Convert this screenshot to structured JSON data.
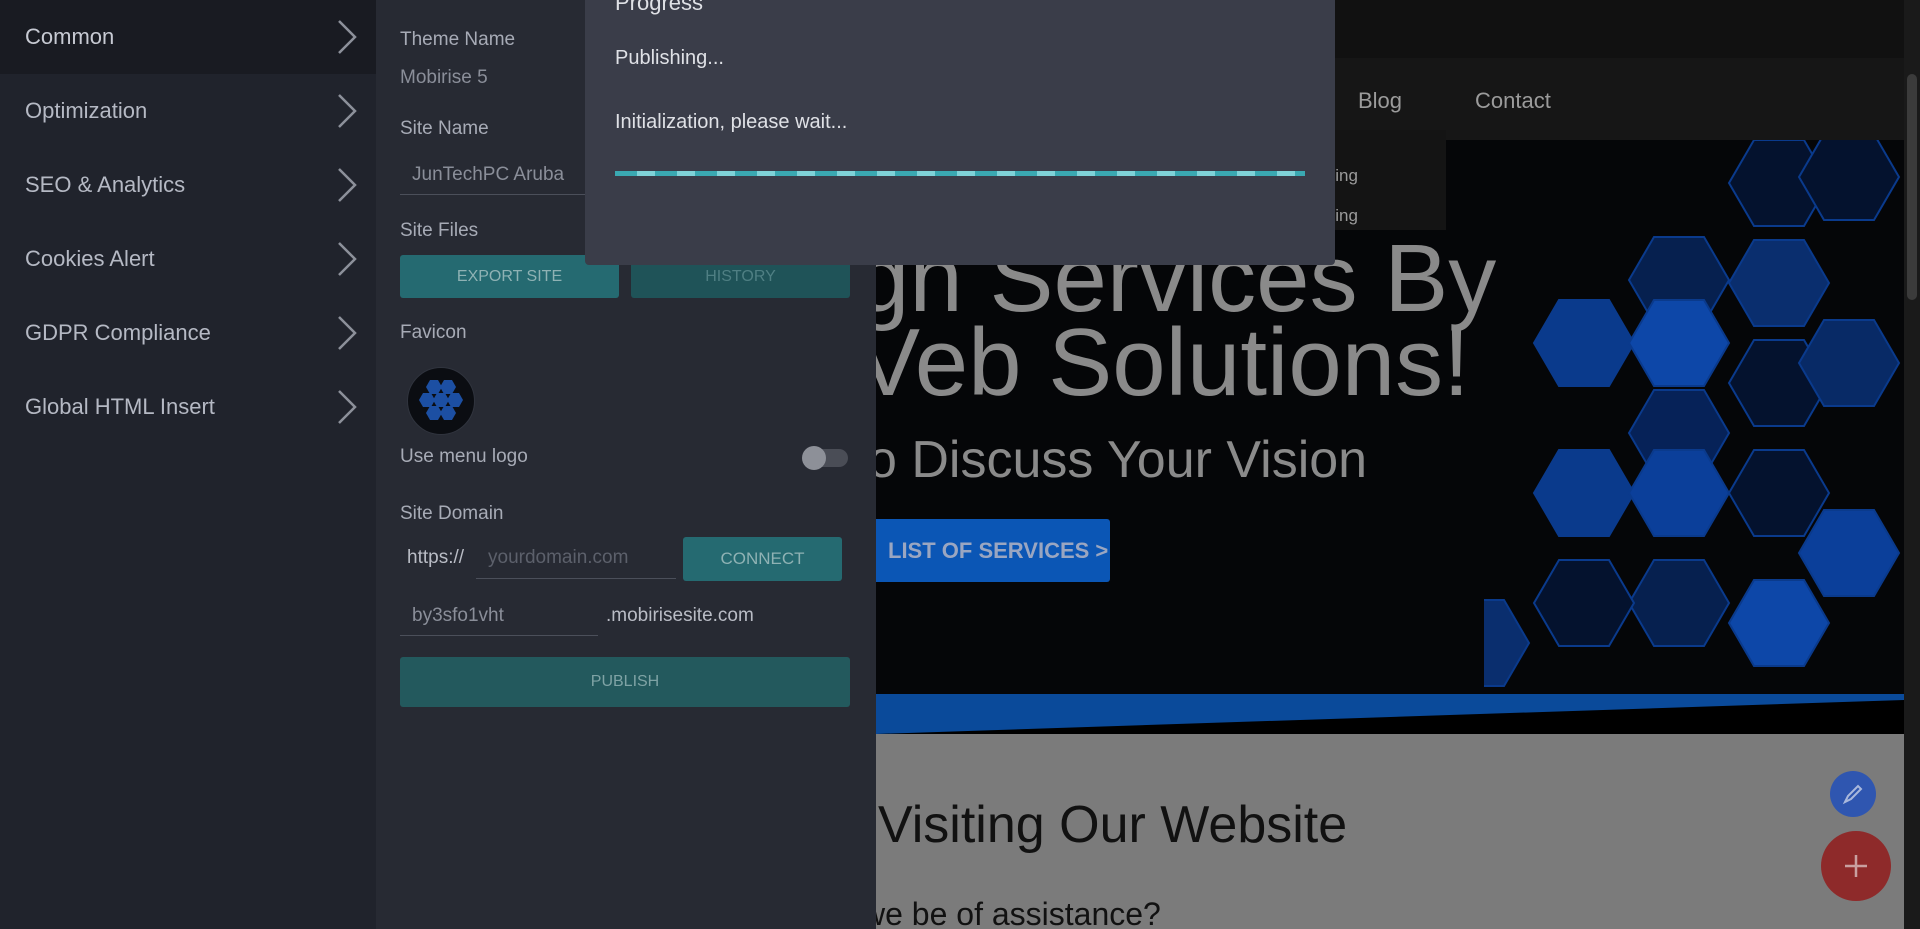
{
  "sidebar": {
    "items": [
      {
        "label": "Common"
      },
      {
        "label": "Optimization"
      },
      {
        "label": "SEO & Analytics"
      },
      {
        "label": "Cookies Alert"
      },
      {
        "label": "GDPR Compliance"
      },
      {
        "label": "Global HTML Insert"
      }
    ]
  },
  "settings": {
    "theme_name_label": "Theme Name",
    "theme_name_value": "Mobirise 5",
    "site_name_label": "Site Name",
    "site_name_value": "JunTechPC Aruba",
    "site_files_label": "Site Files",
    "export_label": "EXPORT SITE",
    "history_label": "HISTORY",
    "favicon_label": "Favicon",
    "menu_logo_label": "Use menu logo",
    "menu_logo_on": false,
    "site_domain_label": "Site Domain",
    "https_prefix": "https://",
    "domain_placeholder": "yourdomain.com",
    "connect_label": "CONNECT",
    "subdomain_value": "by3sfo1vht",
    "subdomain_suffix": ".mobirisesite.com",
    "publish_label": "PUBLISH"
  },
  "modal": {
    "title": "Progress",
    "status": "Publishing...",
    "message": "Initialization, please wait...",
    "progress": 1.0
  },
  "preview": {
    "nav": [
      "Blog",
      "Contact"
    ],
    "dropdown": [
      "Pricing",
      "Pricing"
    ],
    "hero_line1": "gn Services By",
    "hero_line2": "Veb Solutions!",
    "hero_sub": "o Discuss Your Vision",
    "hero_button": "LIST OF SERVICES >",
    "section_title": "Visiting Our Website",
    "section_sub": "we be of assistance?"
  },
  "colors": {
    "accent_teal": "#256a71",
    "progress": "#3aa9b2",
    "hero_blue": "#0b56b5",
    "fab_red": "#8e2a2a"
  }
}
